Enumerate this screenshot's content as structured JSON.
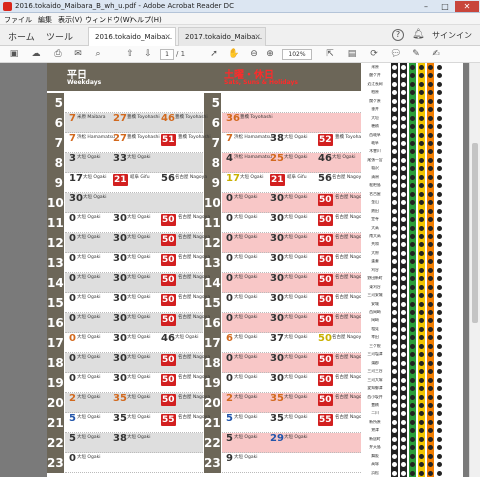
{
  "window": {
    "title": "2016.tokaido_Maibara_B_wh_u.pdf - Adobe Acrobat Reader DC",
    "minimize_glyph": "–",
    "maximize_glyph": "□",
    "close_glyph": "✕"
  },
  "menu": [
    "ファイル",
    "編集",
    "表示(V)",
    "ウィンドウ(W)",
    "ヘルプ(H)"
  ],
  "nav": {
    "home": "ホーム",
    "tools": "ツール",
    "tabs": [
      {
        "label": "2016.tokaido_Maiba...",
        "active": true
      },
      {
        "label": "2017.tokaido_Maiba...",
        "active": false
      }
    ],
    "signin": "サインイン"
  },
  "toolbar": {
    "page_current": "1",
    "page_total": "/ 1",
    "zoom": "102%"
  },
  "timetable": {
    "weekday_title": "平日",
    "weekday_sub": "Weekdays",
    "weekend_title": "土曜・休日",
    "weekend_sub": "Sats, Suns & Holidays",
    "colors": {
      "badge": "#d21f1f",
      "pink": "#f8c7c7",
      "grey": "#dedede",
      "header": "#6c6658"
    },
    "rows": [
      {
        "hour": "5",
        "wd": [],
        "we": []
      },
      {
        "hour": "6",
        "wd": [
          {
            "t": "7",
            "c": "#d2691e",
            "d": "米原 Maibara"
          },
          {
            "t": "27",
            "c": "#d2691e",
            "d": "豊橋 Toyohashi"
          },
          {
            "t": "46",
            "c": "#d2691e",
            "d": "豊橋 Toyohashi"
          }
        ],
        "we": [
          {
            "t": "36",
            "c": "#d2691e",
            "d": "豊橋 Toyohashi"
          }
        ]
      },
      {
        "hour": "7",
        "wd": [
          {
            "t": "7",
            "c": "#d2691e",
            "d": "浜松 Hamamatsu"
          },
          {
            "t": "27",
            "c": "#d2691e",
            "d": "豊橋 Toyohashi"
          },
          {
            "t": "51",
            "c": "#d21f1f",
            "d": "豊橋 Toyohashi",
            "badge": true
          }
        ],
        "we": [
          {
            "t": "7",
            "c": "#d2691e",
            "d": "浜松 Hamamatsu"
          },
          {
            "t": "38",
            "c": "#333",
            "d": "大垣 Ogaki"
          },
          {
            "t": "52",
            "c": "#d21f1f",
            "d": "豊橋 Toyohashi",
            "badge": true
          }
        ]
      },
      {
        "hour": "8",
        "wd": [
          {
            "t": "3",
            "c": "#333",
            "d": "大垣 Ogaki"
          },
          {
            "t": "33",
            "c": "#333",
            "d": "大垣 Ogaki"
          }
        ],
        "we": [
          {
            "t": "4",
            "c": "#333",
            "d": "浜松 Hamamatsu"
          },
          {
            "t": "25",
            "c": "#d2691e",
            "d": "大垣 Ogaki"
          },
          {
            "t": "46",
            "c": "#333",
            "d": "大垣 Ogaki"
          }
        ]
      },
      {
        "hour": "9",
        "wd": [
          {
            "t": "17",
            "c": "#333",
            "d": "大垣 Ogaki"
          },
          {
            "t": "21",
            "c": "#d21f1f",
            "d": "岐阜 Gifu",
            "badge": true
          },
          {
            "t": "56",
            "c": "#333",
            "d": "名古屋 Nagoya"
          }
        ],
        "we": [
          {
            "t": "17",
            "c": "#c9b000",
            "d": "大垣 Ogaki"
          },
          {
            "t": "21",
            "c": "#d21f1f",
            "d": "岐阜 Gifu",
            "badge": true
          },
          {
            "t": "56",
            "c": "#333",
            "d": "名古屋 Nagoya"
          }
        ]
      },
      {
        "hour": "10",
        "wd": [
          {
            "t": "30",
            "c": "#333",
            "d": "大垣 Ogaki"
          }
        ],
        "we": [
          {
            "t": "0",
            "c": "#333",
            "d": "大垣 Ogaki"
          },
          {
            "t": "30",
            "c": "#333",
            "d": "大垣 Ogaki"
          },
          {
            "t": "50",
            "c": "#d21f1f",
            "d": "名古屋 Nagoya",
            "badge": true
          }
        ]
      },
      {
        "hour": "11",
        "wd": [
          {
            "t": "0",
            "c": "#333",
            "d": "大垣 Ogaki"
          },
          {
            "t": "30",
            "c": "#333",
            "d": "大垣 Ogaki"
          },
          {
            "t": "50",
            "c": "#d21f1f",
            "d": "名古屋 Nagoya",
            "badge": true
          }
        ],
        "we": [
          {
            "t": "0",
            "c": "#333",
            "d": "大垣 Ogaki"
          },
          {
            "t": "30",
            "c": "#333",
            "d": "大垣 Ogaki"
          },
          {
            "t": "50",
            "c": "#d21f1f",
            "d": "名古屋 Nagoya",
            "badge": true
          }
        ]
      },
      {
        "hour": "12",
        "wd": [
          {
            "t": "0",
            "c": "#333",
            "d": "大垣 Ogaki"
          },
          {
            "t": "30",
            "c": "#333",
            "d": "大垣 Ogaki"
          },
          {
            "t": "50",
            "c": "#d21f1f",
            "d": "名古屋 Nagoya",
            "badge": true
          }
        ],
        "we": [
          {
            "t": "0",
            "c": "#333",
            "d": "大垣 Ogaki"
          },
          {
            "t": "30",
            "c": "#333",
            "d": "大垣 Ogaki"
          },
          {
            "t": "50",
            "c": "#d21f1f",
            "d": "名古屋 Nagoya",
            "badge": true
          }
        ]
      },
      {
        "hour": "13",
        "wd": [
          {
            "t": "0",
            "c": "#333",
            "d": "大垣 Ogaki"
          },
          {
            "t": "30",
            "c": "#333",
            "d": "大垣 Ogaki"
          },
          {
            "t": "50",
            "c": "#d21f1f",
            "d": "名古屋 Nagoya",
            "badge": true
          }
        ],
        "we": [
          {
            "t": "0",
            "c": "#333",
            "d": "大垣 Ogaki"
          },
          {
            "t": "30",
            "c": "#333",
            "d": "大垣 Ogaki"
          },
          {
            "t": "50",
            "c": "#d21f1f",
            "d": "名古屋 Nagoya",
            "badge": true
          }
        ]
      },
      {
        "hour": "14",
        "wd": [
          {
            "t": "0",
            "c": "#333",
            "d": "大垣 Ogaki"
          },
          {
            "t": "30",
            "c": "#333",
            "d": "大垣 Ogaki"
          },
          {
            "t": "50",
            "c": "#d21f1f",
            "d": "名古屋 Nagoya",
            "badge": true
          }
        ],
        "we": [
          {
            "t": "0",
            "c": "#333",
            "d": "大垣 Ogaki"
          },
          {
            "t": "30",
            "c": "#333",
            "d": "大垣 Ogaki"
          },
          {
            "t": "50",
            "c": "#d21f1f",
            "d": "名古屋 Nagoya",
            "badge": true
          }
        ]
      },
      {
        "hour": "15",
        "wd": [
          {
            "t": "0",
            "c": "#333",
            "d": "大垣 Ogaki"
          },
          {
            "t": "30",
            "c": "#333",
            "d": "大垣 Ogaki"
          },
          {
            "t": "50",
            "c": "#d21f1f",
            "d": "名古屋 Nagoya",
            "badge": true
          }
        ],
        "we": [
          {
            "t": "0",
            "c": "#333",
            "d": "大垣 Ogaki"
          },
          {
            "t": "30",
            "c": "#333",
            "d": "大垣 Ogaki"
          },
          {
            "t": "50",
            "c": "#d21f1f",
            "d": "名古屋 Nagoya",
            "badge": true
          }
        ]
      },
      {
        "hour": "16",
        "wd": [
          {
            "t": "0",
            "c": "#333",
            "d": "大垣 Ogaki"
          },
          {
            "t": "30",
            "c": "#333",
            "d": "大垣 Ogaki"
          },
          {
            "t": "50",
            "c": "#d21f1f",
            "d": "名古屋 Nagoya",
            "badge": true
          }
        ],
        "we": [
          {
            "t": "0",
            "c": "#333",
            "d": "大垣 Ogaki"
          },
          {
            "t": "30",
            "c": "#333",
            "d": "大垣 Ogaki"
          },
          {
            "t": "50",
            "c": "#d21f1f",
            "d": "名古屋 Nagoya",
            "badge": true
          }
        ]
      },
      {
        "hour": "17",
        "wd": [
          {
            "t": "0",
            "c": "#d2691e",
            "d": "大垣 Ogaki"
          },
          {
            "t": "30",
            "c": "#333",
            "d": "大垣 Ogaki"
          },
          {
            "t": "46",
            "c": "#333",
            "d": "大垣 Ogaki"
          }
        ],
        "we": [
          {
            "t": "6",
            "c": "#d2691e",
            "d": "大垣 Ogaki"
          },
          {
            "t": "37",
            "c": "#333",
            "d": "大垣 Ogaki"
          },
          {
            "t": "50",
            "c": "#c9b000",
            "d": "名古屋 Nagoya"
          }
        ]
      },
      {
        "hour": "18",
        "wd": [
          {
            "t": "0",
            "c": "#333",
            "d": "大垣 Ogaki"
          },
          {
            "t": "30",
            "c": "#333",
            "d": "大垣 Ogaki"
          },
          {
            "t": "50",
            "c": "#d21f1f",
            "d": "名古屋 Nagoya",
            "badge": true
          }
        ],
        "we": [
          {
            "t": "0",
            "c": "#333",
            "d": "大垣 Ogaki"
          },
          {
            "t": "30",
            "c": "#333",
            "d": "大垣 Ogaki"
          },
          {
            "t": "50",
            "c": "#d21f1f",
            "d": "名古屋 Nagoya",
            "badge": true
          }
        ]
      },
      {
        "hour": "19",
        "wd": [
          {
            "t": "0",
            "c": "#333",
            "d": "大垣 Ogaki"
          },
          {
            "t": "30",
            "c": "#333",
            "d": "大垣 Ogaki"
          },
          {
            "t": "50",
            "c": "#d21f1f",
            "d": "名古屋 Nagoya",
            "badge": true
          }
        ],
        "we": [
          {
            "t": "0",
            "c": "#333",
            "d": "大垣 Ogaki"
          },
          {
            "t": "30",
            "c": "#333",
            "d": "大垣 Ogaki"
          },
          {
            "t": "50",
            "c": "#d21f1f",
            "d": "名古屋 Nagoya",
            "badge": true
          }
        ]
      },
      {
        "hour": "20",
        "wd": [
          {
            "t": "2",
            "c": "#d2691e",
            "d": "大垣 Ogaki"
          },
          {
            "t": "35",
            "c": "#d2691e",
            "d": "大垣 Ogaki"
          },
          {
            "t": "50",
            "c": "#d21f1f",
            "d": "名古屋 Nagoya",
            "badge": true
          }
        ],
        "we": [
          {
            "t": "2",
            "c": "#d2691e",
            "d": "大垣 Ogaki"
          },
          {
            "t": "35",
            "c": "#d2691e",
            "d": "大垣 Ogaki"
          },
          {
            "t": "50",
            "c": "#d21f1f",
            "d": "名古屋 Nagoya",
            "badge": true
          }
        ]
      },
      {
        "hour": "21",
        "wd": [
          {
            "t": "5",
            "c": "#2255aa",
            "d": "大垣 Ogaki"
          },
          {
            "t": "35",
            "c": "#333",
            "d": "大垣 Ogaki"
          },
          {
            "t": "55",
            "c": "#d21f1f",
            "d": "名古屋 Nagoya",
            "badge": true
          }
        ],
        "we": [
          {
            "t": "5",
            "c": "#2255aa",
            "d": "大垣 Ogaki"
          },
          {
            "t": "35",
            "c": "#333",
            "d": "大垣 Ogaki"
          },
          {
            "t": "55",
            "c": "#d21f1f",
            "d": "名古屋 Nagoya",
            "badge": true
          }
        ]
      },
      {
        "hour": "22",
        "wd": [
          {
            "t": "5",
            "c": "#333",
            "d": "大垣 Ogaki"
          },
          {
            "t": "38",
            "c": "#333",
            "d": "大垣 Ogaki"
          }
        ],
        "we": [
          {
            "t": "5",
            "c": "#333",
            "d": "大垣 Ogaki"
          },
          {
            "t": "29",
            "c": "#2255aa",
            "d": "大垣 Ogaki"
          }
        ]
      },
      {
        "hour": "23",
        "wd": [
          {
            "t": "0",
            "c": "#333",
            "d": "大垣 Ogaki"
          }
        ],
        "we": [
          {
            "t": "9",
            "c": "#333",
            "d": "大垣 Ogaki"
          }
        ]
      }
    ]
  },
  "stations": [
    "米原",
    "醒ケ井",
    "近江長岡",
    "柏原",
    "関ケ原",
    "垂井",
    "大垣",
    "穂積",
    "西岐阜",
    "岐阜",
    "木曽川",
    "尾張一宮",
    "稲沢",
    "清洲",
    "枇杷島",
    "名古屋",
    "金山",
    "熱田",
    "笠寺",
    "大高",
    "南大高",
    "共和",
    "大府",
    "逢妻",
    "刈谷",
    "野田新町",
    "東刈谷",
    "三河安城",
    "安城",
    "西岡崎",
    "岡崎",
    "相見",
    "幸田",
    "三ケ根",
    "三河塩津",
    "蒲郡",
    "三河三谷",
    "三河大塚",
    "愛知御津",
    "西小坂井",
    "豊橋",
    "二川",
    "新所原",
    "鷲津",
    "新居町",
    "弁天島",
    "舞阪",
    "高塚",
    "浜松"
  ]
}
